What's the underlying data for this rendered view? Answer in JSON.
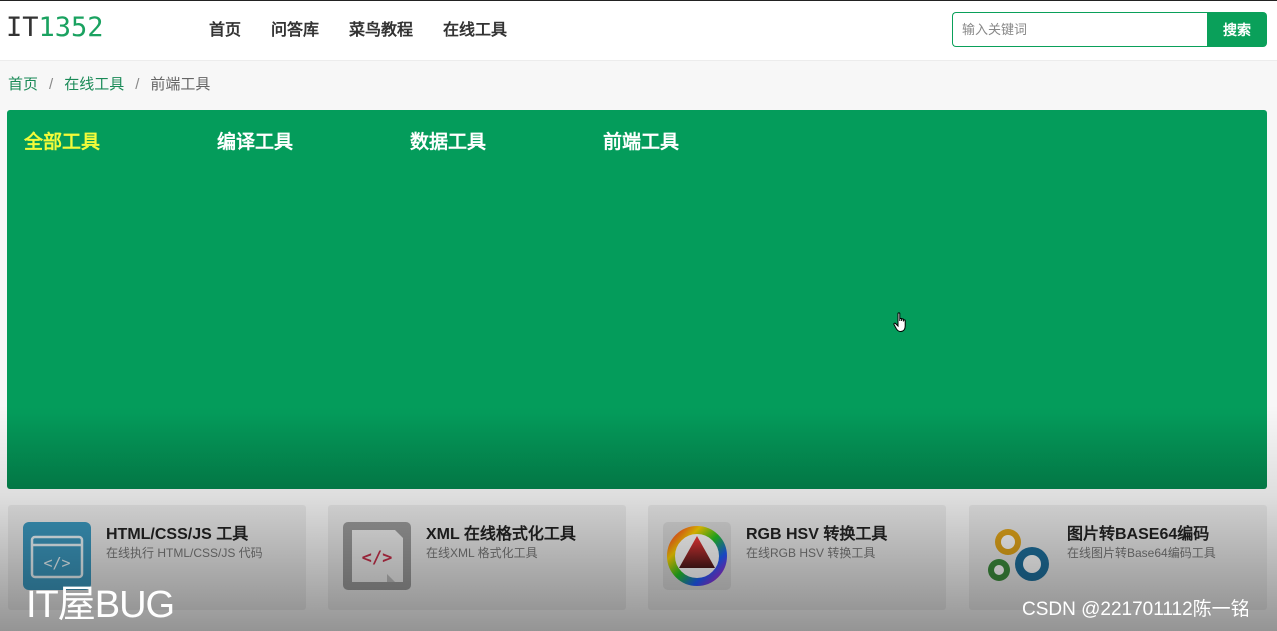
{
  "header": {
    "logo": {
      "part1": "IT",
      "part2": "1352"
    },
    "nav": [
      "首页",
      "问答库",
      "菜鸟教程",
      "在线工具"
    ],
    "search": {
      "placeholder": "输入关键词",
      "value": "",
      "button_label": "搜索"
    }
  },
  "breadcrumb": {
    "items": [
      "首页",
      "在线工具"
    ],
    "current": "前端工具",
    "separator": "/"
  },
  "hero": {
    "tabs": [
      "全部工具",
      "编译工具",
      "数据工具",
      "前端工具"
    ],
    "active_tab_index": 0
  },
  "cards": [
    {
      "title": "HTML/CSS/JS 工具",
      "desc": "在线执行 HTML/CSS/JS 代码",
      "icon": "code-window-icon"
    },
    {
      "title": "XML 在线格式化工具",
      "desc": "在线XML 格式化工具",
      "icon": "xml-file-icon"
    },
    {
      "title": "RGB HSV 转换工具",
      "desc": "在线RGB HSV 转换工具",
      "icon": "color-wheel-icon"
    },
    {
      "title": "图片转BASE64编码",
      "desc": "在线图片转Base64编码工具",
      "icon": "gears-icon"
    }
  ],
  "watermarks": {
    "left": "IT屋BUG",
    "right": "CSDN @221701112陈一铭"
  },
  "colors": {
    "accent": "#049c5b",
    "active_tab": "#f3fb3a",
    "link": "#1a8a57"
  }
}
